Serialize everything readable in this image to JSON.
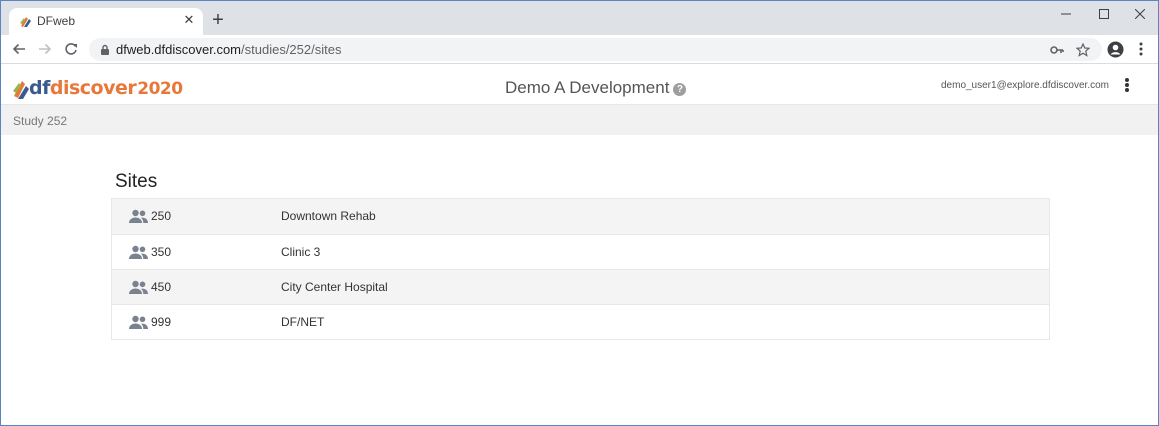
{
  "browser": {
    "tab_title": "DFweb",
    "url_host": "dfweb.dfdiscover.com",
    "url_path": "/studies/252/sites"
  },
  "header": {
    "logo_df": "df",
    "logo_discover": "discover",
    "logo_year": "2020",
    "title": "Demo A Development",
    "help": "?",
    "user_email": "demo_user1@explore.dfdiscover.com"
  },
  "breadcrumb": {
    "label": "Study 252"
  },
  "main": {
    "heading": "Sites",
    "sites": [
      {
        "id": "250",
        "name": "Downtown Rehab"
      },
      {
        "id": "350",
        "name": "Clinic 3"
      },
      {
        "id": "450",
        "name": "City Center Hospital"
      },
      {
        "id": "999",
        "name": "DF/NET"
      }
    ]
  },
  "colors": {
    "logo_blue": "#3b5a8f",
    "logo_orange": "#e8783a",
    "icon_gray": "#7a8290"
  }
}
